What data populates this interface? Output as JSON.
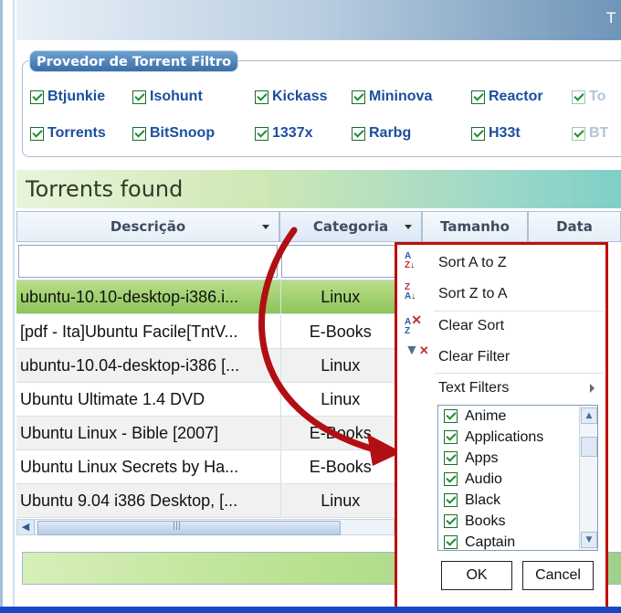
{
  "window": {
    "title_fragment": "T"
  },
  "provider_group": {
    "legend": "Provedor de Torrent Filtro",
    "providers": [
      {
        "label": "Btjunkie",
        "checked": true
      },
      {
        "label": "Isohunt",
        "checked": true
      },
      {
        "label": "Kickass",
        "checked": true
      },
      {
        "label": "Mininova",
        "checked": true
      },
      {
        "label": "Reactor",
        "checked": true
      },
      {
        "label": "To",
        "checked": true
      },
      {
        "label": "Torrents",
        "checked": true
      },
      {
        "label": "BitSnoop",
        "checked": true
      },
      {
        "label": "1337x",
        "checked": true
      },
      {
        "label": "Rarbg",
        "checked": true
      },
      {
        "label": "H33t",
        "checked": true
      },
      {
        "label": "BT",
        "checked": true
      }
    ]
  },
  "results": {
    "title": "Torrents found",
    "columns": [
      "Descrição",
      "Categoria",
      "Tamanho",
      "Data"
    ],
    "rows": [
      {
        "descricao": "ubuntu-10.10-desktop-i386.i...",
        "categoria": "Linux",
        "selected": true
      },
      {
        "descricao": "[pdf - Ita]Ubuntu Facile[TntV...",
        "categoria": "E-Books"
      },
      {
        "descricao": "ubuntu-10.04-desktop-i386 [...",
        "categoria": "Linux"
      },
      {
        "descricao": "Ubuntu Ultimate 1.4 DVD",
        "categoria": "Linux"
      },
      {
        "descricao": "Ubuntu Linux - Bible [2007]",
        "categoria": "E-Books"
      },
      {
        "descricao": "Ubuntu Linux Secrets by Ha...",
        "categoria": "E-Books"
      },
      {
        "descricao": "Ubuntu 9.04 i386 Desktop, [...",
        "categoria": "Linux"
      }
    ]
  },
  "filter_menu": {
    "items": [
      {
        "label": "Sort A to Z",
        "icon": "sort-ascending-icon"
      },
      {
        "label": "Sort Z to A",
        "icon": "sort-descending-icon"
      },
      {
        "label": "Clear Sort",
        "icon": "clear-sort-icon"
      },
      {
        "label": "Clear Filter",
        "icon": "clear-filter-icon"
      },
      {
        "label": "Text Filters",
        "icon": "submenu-arrow-icon"
      }
    ],
    "values": [
      {
        "label": "Anime",
        "checked": true
      },
      {
        "label": "Applications",
        "checked": true
      },
      {
        "label": "Apps",
        "checked": true
      },
      {
        "label": "Audio",
        "checked": true
      },
      {
        "label": "Black",
        "checked": true
      },
      {
        "label": "Books",
        "checked": true
      },
      {
        "label": "Captain",
        "checked": true
      }
    ],
    "ok_label": "OK",
    "cancel_label": "Cancel"
  },
  "colors": {
    "highlight_border": "#c00d0d",
    "selected_row": "#9ccc6a",
    "accent": "#1a4f9c"
  }
}
